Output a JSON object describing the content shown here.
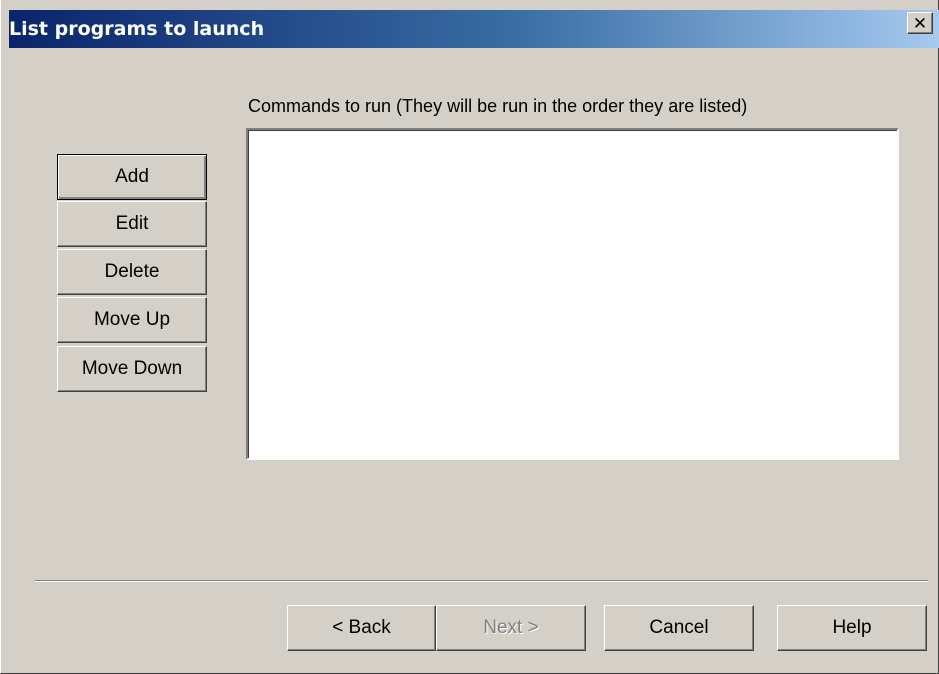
{
  "window": {
    "title": "List programs to launch",
    "close_glyph": "✕"
  },
  "commands": {
    "label": "Commands to run (They will be run in the order they are listed)",
    "items": []
  },
  "side_buttons": {
    "add": "Add",
    "edit": "Edit",
    "delete": "Delete",
    "move_up": "Move Up",
    "move_down": "Move Down"
  },
  "nav_buttons": {
    "back": "< Back",
    "next": "Next >",
    "cancel": "Cancel",
    "help": "Help"
  },
  "colors": {
    "title_gradient_start": "#0a246a",
    "title_gradient_end": "#a6caf0",
    "face": "#d4d0c8",
    "disabled_text": "#808080"
  }
}
